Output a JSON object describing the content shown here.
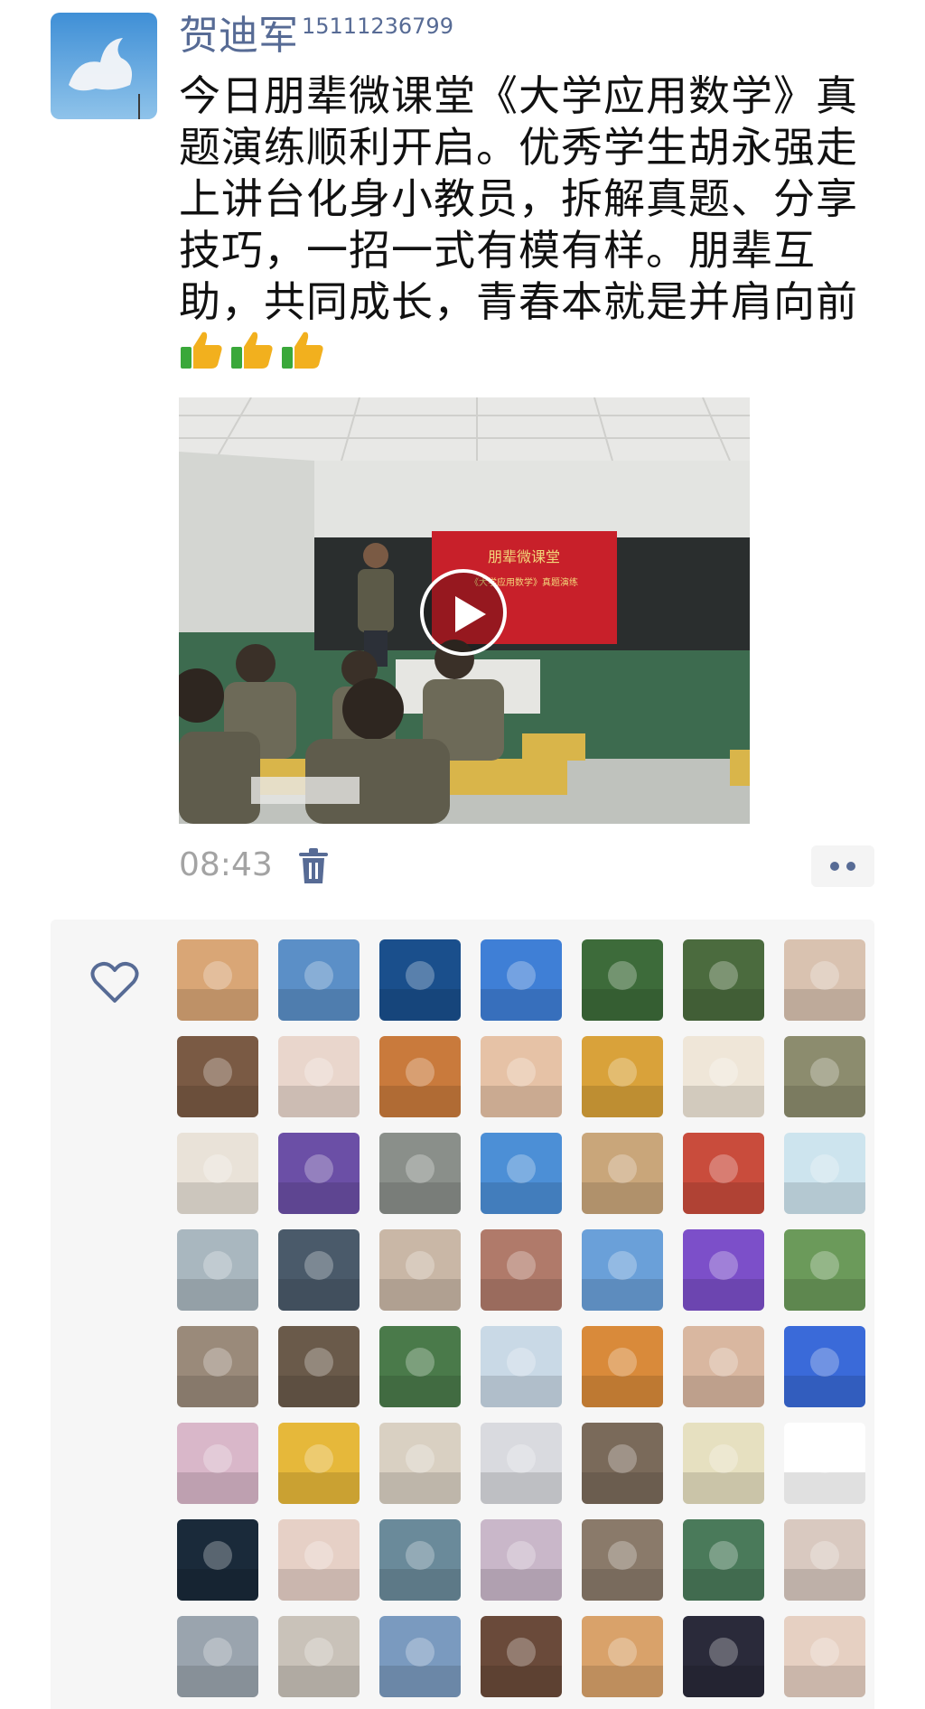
{
  "post": {
    "author_name": "贺迪军",
    "author_phone": "15111236799",
    "text": "今日朋辈微课堂《大学应用数学》真题演练顺利开启。优秀学生胡永强走上讲台化身小教员，拆解真题、分享技巧，一招一式有模有样。朋辈互助，共同成长，青春本就是并肩向前",
    "emoji": [
      "thumbs-up",
      "thumbs-up",
      "thumbs-up"
    ],
    "video": {
      "slide_title": "朋辈微课堂",
      "slide_subtitle": "《大学应用数学》真题演练"
    },
    "time": "08:43"
  },
  "likes": {
    "avatar_count": 56,
    "colors": [
      [
        "#d9a676",
        "#5b8fc7",
        "#1a4f8c",
        "#3f7fd6",
        "#3d6b3a",
        "#4b6b3e",
        "#d9c2b0"
      ],
      [
        "#7a5a44",
        "#e9d6cc",
        "#c97a3c",
        "#e6c2a6",
        "#d9a23a",
        "#efe6d8",
        "#8c8c6e"
      ],
      [
        "#e9e2d8",
        "#6b4fa6",
        "#8a8f8a",
        "#4c8fd6",
        "#c9a67a",
        "#c94c3c",
        "#cde4ee"
      ],
      [
        "#a9b7bf",
        "#4a5a6a",
        "#c9b7a6",
        "#b07a6a",
        "#6aa0d9",
        "#7c4fc9",
        "#6b9a5a"
      ],
      [
        "#9a8a7a",
        "#6a5a4a",
        "#4a7a4a",
        "#c9d9e6",
        "#d98a3a",
        "#d9b7a0",
        "#3a6ad9"
      ],
      [
        "#d9b7c9",
        "#e6b83a",
        "#d9d0c2",
        "#d9dadf",
        "#7a6a5a",
        "#e6e0c0",
        "#ffffff"
      ],
      [
        "#1a2a3a",
        "#e6d0c6",
        "#6a8a9a",
        "#c9b7c9",
        "#8a7a6a",
        "#4a7a5a",
        "#d9c9c0"
      ],
      [
        "#9aa4ae",
        "#c9c2b9",
        "#7a9abf",
        "#6a4a3a",
        "#d9a26a",
        "#2a2a3a",
        "#e6d0c2"
      ]
    ]
  }
}
